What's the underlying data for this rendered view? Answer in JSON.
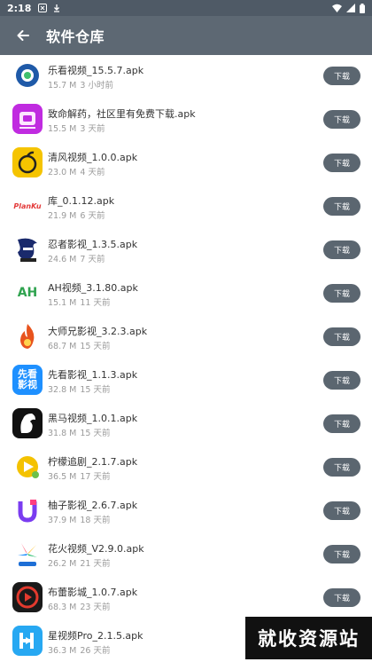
{
  "status_bar": {
    "time": "2:18"
  },
  "header": {
    "title": "软件仓库"
  },
  "download_label": "下载",
  "apps": [
    {
      "name": "乐看视频_15.5.7.apk",
      "size": "15.7 M",
      "age": "3 小时前",
      "icon": "leyou-icon",
      "color": "#1f5aa8"
    },
    {
      "name": "致命解药，社区里有免费下载.apk",
      "size": "15.5 M",
      "age": "3 天前",
      "icon": "toy-box-icon",
      "color": "#c02be0"
    },
    {
      "name": "清风视频_1.0.0.apk",
      "size": "23.0 M",
      "age": "4 天前",
      "icon": "orange-icon",
      "color": "#f5c400"
    },
    {
      "name": "库_0.1.12.apk",
      "size": "21.9 M",
      "age": "6 天前",
      "icon": "plankton-logo-icon",
      "color": "#e33b3b",
      "logo_text": "PlanKu"
    },
    {
      "name": "忍者影视_1.3.5.apk",
      "size": "24.6 M",
      "age": "7 天前",
      "icon": "ninja-icon",
      "color": "#1a2a6c"
    },
    {
      "name": "AH视频_3.1.80.apk",
      "size": "15.1 M",
      "age": "11 天前",
      "icon": "ah-logo-icon",
      "color": "#2fa34f",
      "logo_text": "AH"
    },
    {
      "name": "大师兄影视_3.2.3.apk",
      "size": "68.7 M",
      "age": "15 天前",
      "icon": "flame-icon",
      "color": "#e8531d"
    },
    {
      "name": "先看影视_1.1.3.apk",
      "size": "32.8 M",
      "age": "15 天前",
      "icon": "xiankan-icon",
      "color": "#1e90ff",
      "logo_text": "先看影视"
    },
    {
      "name": "黑马视频_1.0.1.apk",
      "size": "31.8 M",
      "age": "15 天前",
      "icon": "horse-icon",
      "color": "#111111"
    },
    {
      "name": "柠檬追剧_2.1.7.apk",
      "size": "36.5 M",
      "age": "17 天前",
      "icon": "lemon-play-icon",
      "color": "#f4c200"
    },
    {
      "name": "柚子影视_2.6.7.apk",
      "size": "37.9 M",
      "age": "18 天前",
      "icon": "u-logo-icon",
      "color": "#7a3cf0"
    },
    {
      "name": "花火视频_V2.9.0.apk",
      "size": "26.2 M",
      "age": "21 天前",
      "icon": "firework-icon",
      "color": "#ff4f6d"
    },
    {
      "name": "布蕾影城_1.0.7.apk",
      "size": "68.3 M",
      "age": "23 天前",
      "icon": "d-play-icon",
      "color": "#e23a2e"
    },
    {
      "name": "星视频Pro_2.1.5.apk",
      "size": "36.3 M",
      "age": "26 天前",
      "icon": "h-logo-icon",
      "color": "#27a8f2"
    }
  ],
  "watermark": {
    "text": "就收资源站"
  }
}
